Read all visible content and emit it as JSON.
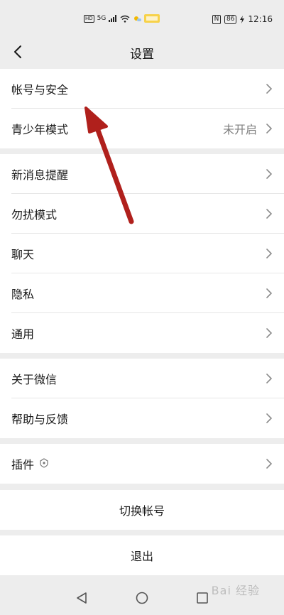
{
  "status_bar": {
    "hd": "HD",
    "network": "5G",
    "nfc": "N",
    "battery": "86",
    "time": "12:16"
  },
  "header": {
    "title": "设置",
    "back_icon": "chevron-left-icon"
  },
  "groups": [
    {
      "items": [
        {
          "label": "帐号与安全",
          "value": ""
        },
        {
          "label": "青少年模式",
          "value": "未开启"
        }
      ]
    },
    {
      "items": [
        {
          "label": "新消息提醒",
          "value": ""
        },
        {
          "label": "勿扰模式",
          "value": ""
        },
        {
          "label": "聊天",
          "value": ""
        },
        {
          "label": "隐私",
          "value": ""
        },
        {
          "label": "通用",
          "value": ""
        }
      ]
    },
    {
      "items": [
        {
          "label": "关于微信",
          "value": ""
        },
        {
          "label": "帮助与反馈",
          "value": ""
        }
      ]
    },
    {
      "items": [
        {
          "label": "插件",
          "value": "",
          "icon": "plugin-icon"
        }
      ]
    }
  ],
  "actions": {
    "switch_account": "切换帐号",
    "logout": "退出"
  },
  "watermark": "Bai 经验",
  "colors": {
    "background": "#ededed",
    "card": "#ffffff",
    "text": "#191919",
    "secondary": "#7f7f7f",
    "annotation_arrow": "#b0201c"
  }
}
